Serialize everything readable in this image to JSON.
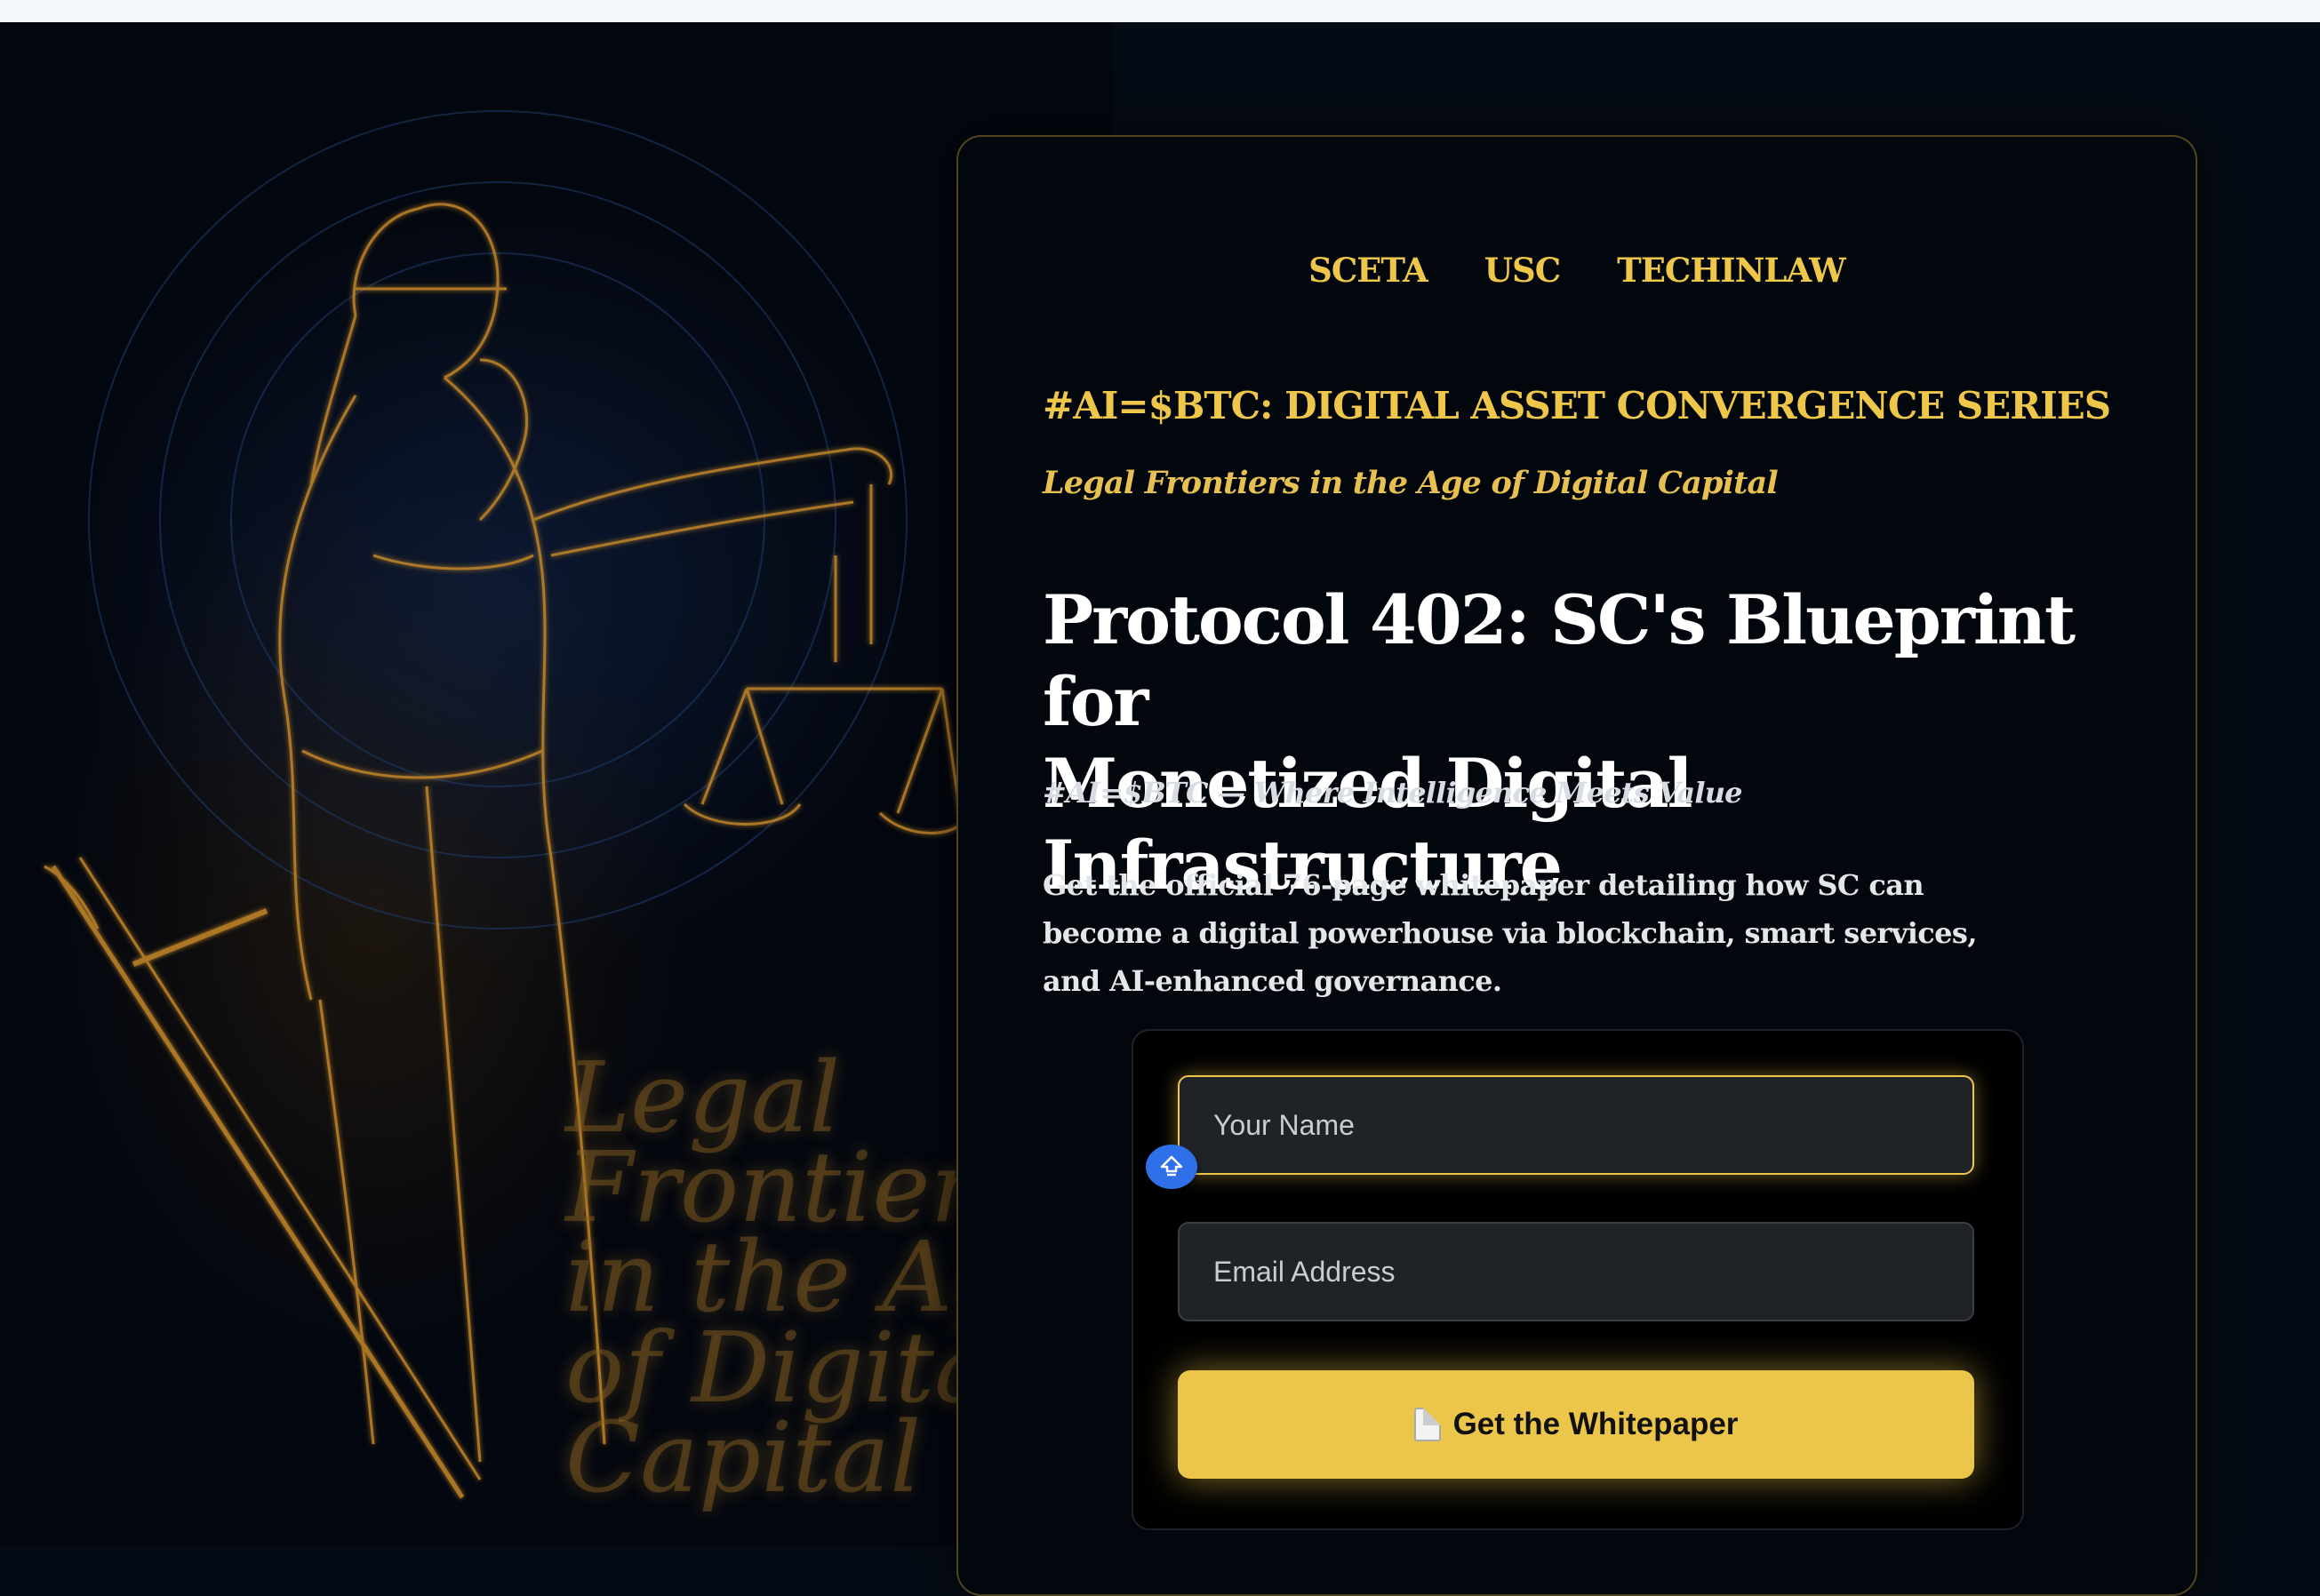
{
  "brands": [
    "SCETA",
    "USC",
    "TECHINLAW"
  ],
  "series_title": "#AI=$BTC: DIGITAL ASSET CONVERGENCE SERIES",
  "series_subtitle": "Legal Frontiers in the Age of Digital Capital",
  "title_line1": "Protocol 402: SC's Blueprint for",
  "title_line2": "Monetized Digital Infrastructure",
  "tagline": "#AI=$BTC — Where Intelligence Meets Value",
  "description": "Get the official 76-page whitepaper detailing how SC can become a digital powerhouse via blockchain, smart services, and AI-enhanced governance.",
  "form": {
    "name_placeholder": "Your Name",
    "email_placeholder": "Email Address",
    "submit_label": "Get the Whitepaper"
  },
  "background_overlay_text": "Legal Frontiers in the Age of Digital Capital",
  "colors": {
    "accent_gold": "#ecc64a",
    "card_bg": "#02060d",
    "page_bg": "#050b14",
    "badge_blue": "#2f6fe8"
  }
}
